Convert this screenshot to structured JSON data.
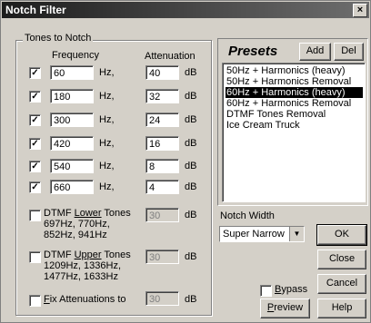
{
  "window": {
    "title": "Notch Filter",
    "close_glyph": "×"
  },
  "tones_group": {
    "legend": "Tones to Notch",
    "header_frequency": "Frequency",
    "header_attenuation": "Attenuation",
    "hz_unit": "Hz,",
    "db_unit": "dB",
    "rows": [
      {
        "checked": "✓",
        "frequency": "60",
        "attenuation": "40"
      },
      {
        "checked": "✓",
        "frequency": "180",
        "attenuation": "32"
      },
      {
        "checked": "✓",
        "frequency": "300",
        "attenuation": "24"
      },
      {
        "checked": "✓",
        "frequency": "420",
        "attenuation": "16"
      },
      {
        "checked": "✓",
        "frequency": "540",
        "attenuation": "8"
      },
      {
        "checked": "✓",
        "frequency": "660",
        "attenuation": "4"
      }
    ],
    "dtmf_lower": {
      "label_u": "Lower",
      "label_pre": "DTMF ",
      "label_post": " Tones",
      "line2": "697Hz, 770Hz,",
      "line3": "852Hz, 941Hz",
      "attenuation": "30"
    },
    "dtmf_upper": {
      "label_u": "Upper",
      "label_pre": "DTMF ",
      "label_post": " Tones",
      "line2": "1209Hz, 1336Hz,",
      "line3": "1477Hz, 1633Hz",
      "attenuation": "30"
    },
    "fix_atten": {
      "label_u": "F",
      "label_post": "ix Attenuations to",
      "attenuation": "30"
    }
  },
  "presets": {
    "title": "Presets",
    "add_label": "Add",
    "del_label": "Del",
    "items": [
      "50Hz + Harmonics (heavy)",
      "50Hz + Harmonics Removal",
      "60Hz + Harmonics (heavy)",
      "60Hz + Harmonics Removal",
      "DTMF Tones Removal",
      "Ice Cream Truck"
    ],
    "selected_index": 2
  },
  "notch_width": {
    "label": "Notch Width",
    "value": "Super Narrow",
    "arrow": "▼"
  },
  "buttons": {
    "ok": "OK",
    "close": "Close",
    "cancel": "Cancel",
    "preview_u": "P",
    "preview_post": "review",
    "help": "Help"
  },
  "bypass": {
    "label_u": "B",
    "label_post": "ypass"
  }
}
